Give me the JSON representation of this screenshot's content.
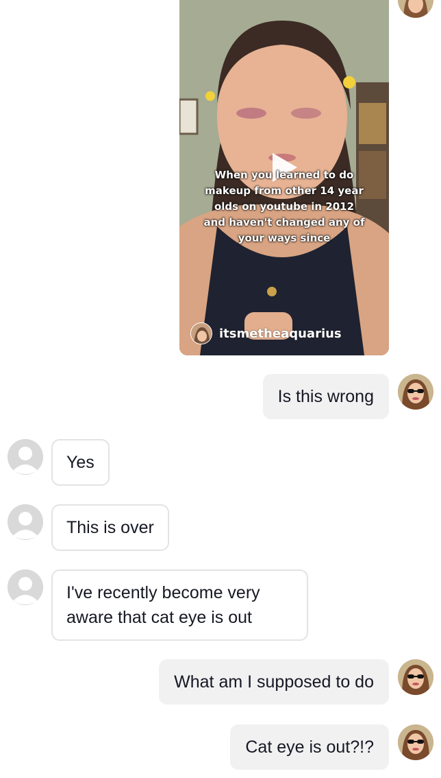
{
  "video": {
    "caption": "When you learned to do\nmakeup from other 14 year\nolds on youtube in 2012\nand haven't changed any of\nyour ways since",
    "author": "itsmetheaquarius"
  },
  "messages": [
    {
      "side": "sent",
      "text": "Is this wrong"
    },
    {
      "side": "recv",
      "text": "Yes"
    },
    {
      "side": "recv",
      "text": "This is over"
    },
    {
      "side": "recv",
      "text": "I've recently become very aware that cat eye is out"
    },
    {
      "side": "sent",
      "text": "What am I supposed to do"
    },
    {
      "side": "sent",
      "text": "Cat eye is out?!?"
    }
  ],
  "colors": {
    "sent_bubble": "#f1f1f2",
    "recv_border": "#e3e3e4",
    "text": "#161823"
  }
}
